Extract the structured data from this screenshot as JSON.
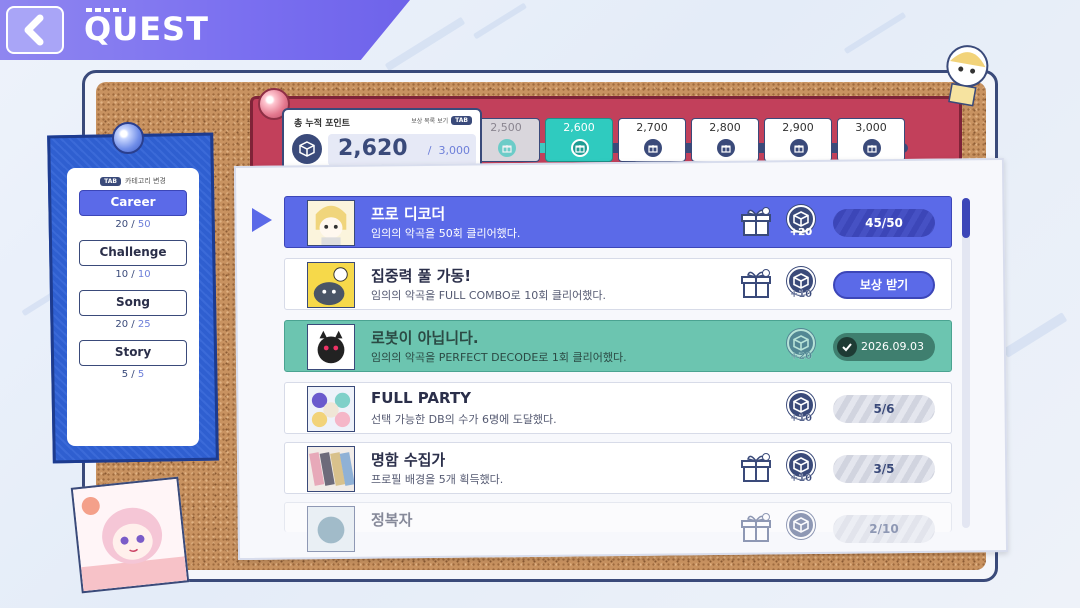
{
  "header": {
    "title": "QUEST"
  },
  "categories": {
    "tab_key": "TAB",
    "tab_hint": "카테고리 변경",
    "items": [
      {
        "label": "Career",
        "done": "20",
        "total": "50",
        "active": true
      },
      {
        "label": "Challenge",
        "done": "10",
        "total": "10",
        "active": false
      },
      {
        "label": "Song",
        "done": "20",
        "total": "25",
        "active": false
      },
      {
        "label": "Story",
        "done": "5",
        "total": "5",
        "active": false
      }
    ]
  },
  "points": {
    "label": "총 누적 포인트",
    "hint": "보상 목록 보기",
    "tab_key": "TAB",
    "current": "2,620",
    "max": "3,000",
    "progress_fraction": 0.2
  },
  "milestones": [
    {
      "value": "2,500",
      "state": "done"
    },
    {
      "value": "2,600",
      "state": "current"
    },
    {
      "value": "2,700",
      "state": "locked"
    },
    {
      "value": "2,800",
      "state": "locked"
    },
    {
      "value": "2,900",
      "state": "locked"
    },
    {
      "value": "3,000",
      "state": "locked"
    }
  ],
  "quests": [
    {
      "title": "프로 디코더",
      "desc": "임의의 악곡을 50회 클리어했다.",
      "reward": "+20",
      "status": "45/50",
      "state": "selected",
      "has_gift": true
    },
    {
      "title": "집중력 풀 가동!",
      "desc": "임의의 악곡을 FULL COMBO로 10회 클리어했다.",
      "reward": "+10",
      "status": "보상 받기",
      "state": "claimable",
      "has_gift": true
    },
    {
      "title": "로봇이 아닙니다.",
      "desc": "임의의 악곡을 PERFECT DECODE로 1회 클리어했다.",
      "reward": "+20",
      "status": "2026.09.03",
      "state": "completed",
      "has_gift": false
    },
    {
      "title": "FULL PARTY",
      "desc": "선택 가능한 DB의 수가 6명에 도달했다.",
      "reward": "+10",
      "status": "5/6",
      "state": "progress",
      "has_gift": false
    },
    {
      "title": "명함 수집가",
      "desc": "프로필 배경을 5개 획득했다.",
      "reward": "+10",
      "status": "3/5",
      "state": "progress",
      "has_gift": true
    },
    {
      "title": "정복자",
      "desc": "",
      "reward": "",
      "status": "2/10",
      "state": "partial",
      "has_gift": true
    }
  ],
  "colors": {
    "accent": "#5b6ae8",
    "completed": "#6cc5b0",
    "ribbon": "#c2405b",
    "teal": "#2fcbbf"
  }
}
